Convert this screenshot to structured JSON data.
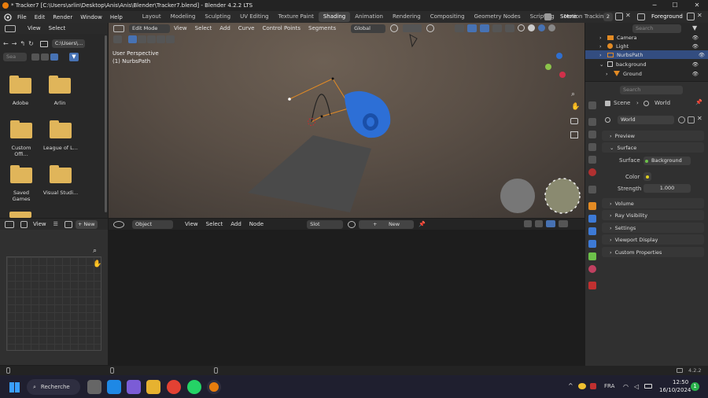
{
  "window": {
    "title": "* Tracker7 [C:\\Users\\arlin\\Desktop\\Anis\\Anis\\Blender\\Tracker7.blend] - Blender 4.2.2 LTS",
    "minimize": "─",
    "maximize": "☐",
    "close": "✕"
  },
  "menu": [
    "File",
    "Edit",
    "Render",
    "Window",
    "Help"
  ],
  "workspaces": [
    "Layout",
    "Modeling",
    "Sculpting",
    "UV Editing",
    "Texture Paint",
    "Shading",
    "Animation",
    "Rendering",
    "Compositing",
    "Geometry Nodes",
    "Scripting",
    "Motion Tracking"
  ],
  "active_workspace": "Shading",
  "scene": {
    "name": "Scene",
    "users": "2",
    "view_layer": "Foreground"
  },
  "file_browser": {
    "view": "View",
    "select": "Select",
    "path": "C:\\Users\\...",
    "search_placeholder": "Sea",
    "folders": [
      "Adobe",
      "Arlin",
      "Custom Offi...",
      "League of L...",
      "Saved Games",
      "Visual Studi..."
    ]
  },
  "viewport": {
    "mode": "Edit Mode",
    "menu": [
      "View",
      "Select",
      "Add",
      "Curve",
      "Control Points",
      "Segments"
    ],
    "transform": "Global",
    "overlay_text": "User Perspective",
    "object_text": "(1) NurbsPath"
  },
  "outliner": {
    "search_placeholder": "Search",
    "items": [
      {
        "name": "Camera",
        "icon": "camera-icon"
      },
      {
        "name": "Light",
        "icon": "light-icon"
      },
      {
        "name": "NurbsPath",
        "icon": "curve-icon",
        "selected": true
      },
      {
        "name": "background",
        "icon": "collection-icon"
      },
      {
        "name": "Ground",
        "icon": "mesh-icon"
      }
    ]
  },
  "properties": {
    "search_placeholder": "Search",
    "breadcrumb_scene": "Scene",
    "breadcrumb_world": "World",
    "world_name": "World",
    "sections": [
      "Preview",
      "Surface"
    ],
    "surface_label": "Surface",
    "surface_value": "Background",
    "color_label": "Color",
    "strength_label": "Strength",
    "strength_value": "1.000",
    "more_sections": [
      "Volume",
      "Ray Visibility",
      "Settings",
      "Viewport Display",
      "Custom Properties"
    ]
  },
  "image_editor": {
    "view": "View",
    "new": "New"
  },
  "node_editor": {
    "object": "Object",
    "menu": [
      "View",
      "Select",
      "Add",
      "Node"
    ],
    "slot": "Slot",
    "new": "New"
  },
  "status": {
    "version": "4.2.2"
  },
  "taskbar": {
    "search": "Recherche",
    "lang": "FRA",
    "time": "12:50",
    "date": "16/10/2024",
    "notifications": "1"
  },
  "colors": {
    "accent": "#4772b3",
    "selected_row": "#334d80",
    "viewport_bg": "#5e5249"
  }
}
